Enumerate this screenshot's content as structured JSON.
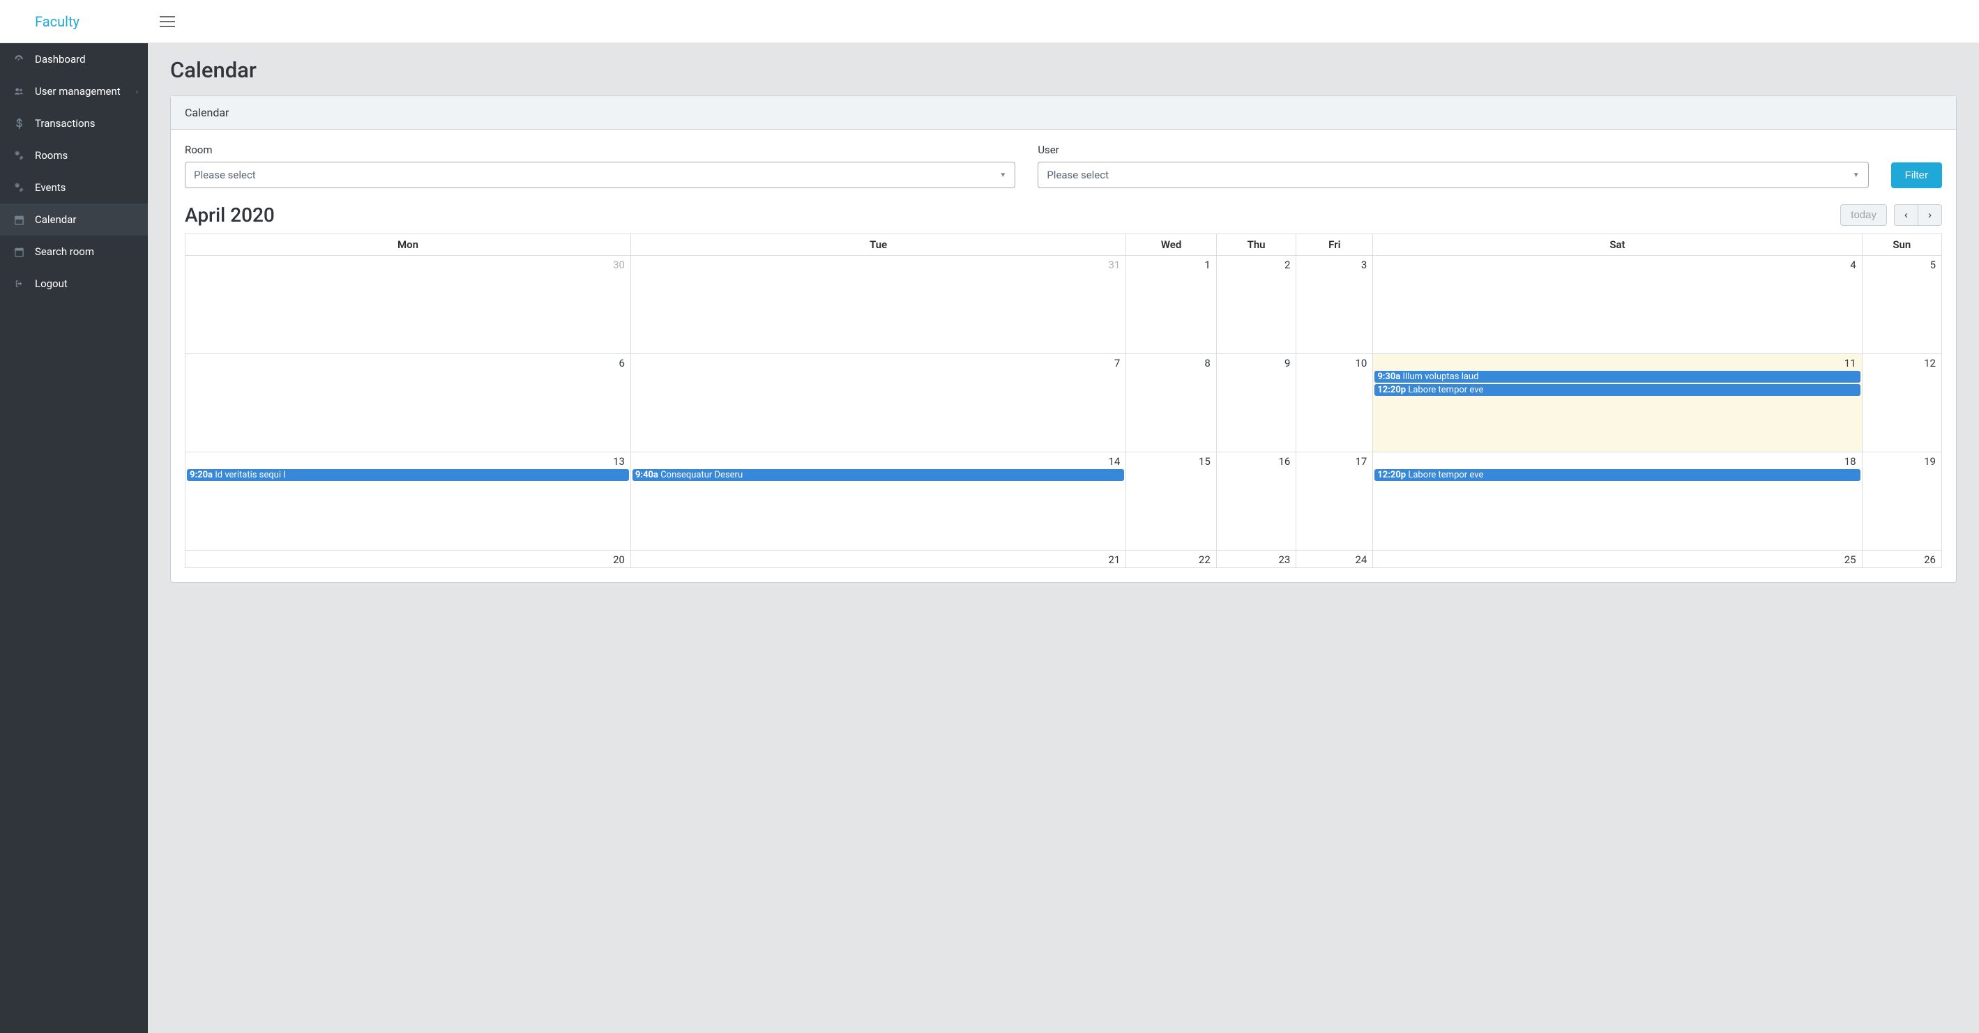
{
  "brand": "Faculty",
  "sidebar": {
    "items": [
      {
        "label": "Dashboard",
        "icon": "dashboard-icon"
      },
      {
        "label": "User management",
        "icon": "users-icon",
        "caret": true
      },
      {
        "label": "Transactions",
        "icon": "dollar-icon"
      },
      {
        "label": "Rooms",
        "icon": "gears-icon"
      },
      {
        "label": "Events",
        "icon": "gears-icon"
      },
      {
        "label": "Calendar",
        "icon": "calendar-icon",
        "active": true
      },
      {
        "label": "Search room",
        "icon": "calendar-icon"
      },
      {
        "label": "Logout",
        "icon": "logout-icon"
      }
    ]
  },
  "page": {
    "title": "Calendar"
  },
  "card": {
    "header": "Calendar"
  },
  "filter": {
    "room_label": "Room",
    "room_value": "Please select",
    "user_label": "User",
    "user_value": "Please select",
    "button": "Filter"
  },
  "calendar": {
    "title": "April 2020",
    "today_label": "today",
    "day_headers": [
      "Mon",
      "Tue",
      "Wed",
      "Thu",
      "Fri",
      "Sat",
      "Sun"
    ],
    "weeks": [
      [
        {
          "n": "30",
          "other": true
        },
        {
          "n": "31",
          "other": true
        },
        {
          "n": "1"
        },
        {
          "n": "2"
        },
        {
          "n": "3"
        },
        {
          "n": "4"
        },
        {
          "n": "5"
        }
      ],
      [
        {
          "n": "6"
        },
        {
          "n": "7"
        },
        {
          "n": "8"
        },
        {
          "n": "9"
        },
        {
          "n": "10"
        },
        {
          "n": "11",
          "today": true,
          "events": [
            {
              "time": "9:30a",
              "title": "Illum voluptas laud"
            },
            {
              "time": "12:20p",
              "title": "Labore tempor eve"
            }
          ]
        },
        {
          "n": "12"
        }
      ],
      [
        {
          "n": "13",
          "events": [
            {
              "time": "9:20a",
              "title": "Id veritatis sequi l"
            }
          ]
        },
        {
          "n": "14",
          "events": [
            {
              "time": "9:40a",
              "title": "Consequatur Deseru"
            }
          ]
        },
        {
          "n": "15"
        },
        {
          "n": "16"
        },
        {
          "n": "17"
        },
        {
          "n": "18",
          "events": [
            {
              "time": "12:20p",
              "title": "Labore tempor eve"
            }
          ]
        },
        {
          "n": "19"
        }
      ],
      [
        {
          "n": "20"
        },
        {
          "n": "21"
        },
        {
          "n": "22"
        },
        {
          "n": "23"
        },
        {
          "n": "24"
        },
        {
          "n": "25"
        },
        {
          "n": "26"
        }
      ]
    ]
  }
}
